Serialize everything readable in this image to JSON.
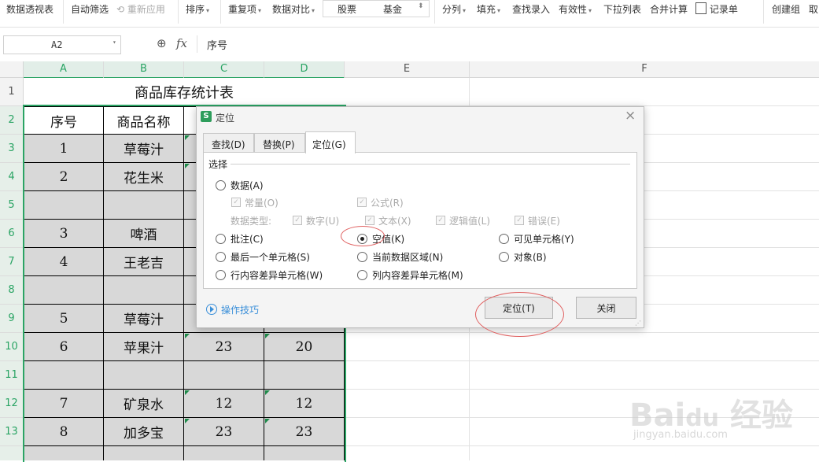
{
  "ribbon": {
    "pivot_table": "数据透视表",
    "auto_filter": "自动筛选",
    "reapply": "重新应用",
    "sort": "排序",
    "duplicates": "重复项",
    "data_compare": "数据对比",
    "stocks": "股票",
    "funds": "基金",
    "split": "分列",
    "fill": "填充",
    "lookup_entry": "查找录入",
    "validity": "有效性",
    "dropdown_list": "下拉列表",
    "consolidate": "合并计算",
    "record_form": "记录单",
    "create_group": "创建组",
    "cancel_group_partial": "取"
  },
  "formula_bar": {
    "name_box": "A2",
    "fx": "fx",
    "formula": "序号"
  },
  "columns": [
    "A",
    "B",
    "C",
    "D",
    "E",
    "F"
  ],
  "rows": [
    "1",
    "2",
    "3",
    "4",
    "5",
    "6",
    "7",
    "8",
    "9",
    "10",
    "11",
    "12",
    "13"
  ],
  "sheet": {
    "title": "商品库存统计表",
    "header": [
      "序号",
      "商品名称"
    ],
    "r3": [
      "1",
      "草莓汁"
    ],
    "r4": [
      "2",
      "花生米"
    ],
    "r6": [
      "3",
      "啤酒"
    ],
    "r7": [
      "4",
      "王老吉"
    ],
    "r9": [
      "5",
      "草莓汁"
    ],
    "r10": [
      "6",
      "苹果汁",
      "23",
      "20"
    ],
    "r12": [
      "7",
      "矿泉水",
      "12",
      "12"
    ],
    "r13": [
      "8",
      "加多宝",
      "23",
      "23"
    ]
  },
  "dialog": {
    "app_badge": "S",
    "title": "定位",
    "close": "×",
    "tabs": [
      "查找(D)",
      "替换(P)",
      "定位(G)"
    ],
    "group_label": "选择",
    "data": "数据(A)",
    "constant": "常量(O)",
    "formula": "公式(R)",
    "data_type": "数据类型:",
    "number": "数字(U)",
    "text": "文本(X)",
    "logical": "逻辑值(L)",
    "error": "错误(E)",
    "comment": "批注(C)",
    "blank": "空值(K)",
    "visible_cells": "可见单元格(Y)",
    "last_cell": "最后一个单元格(S)",
    "current_region": "当前数据区域(N)",
    "objects": "对象(B)",
    "row_diff": "行内容差异单元格(W)",
    "col_diff": "列内容差异单元格(M)",
    "tips": "操作技巧",
    "goto_button": "定位(T)",
    "close_button": "关闭"
  },
  "colors": {
    "accent": "#2aa464",
    "annotation": "#e06060"
  }
}
